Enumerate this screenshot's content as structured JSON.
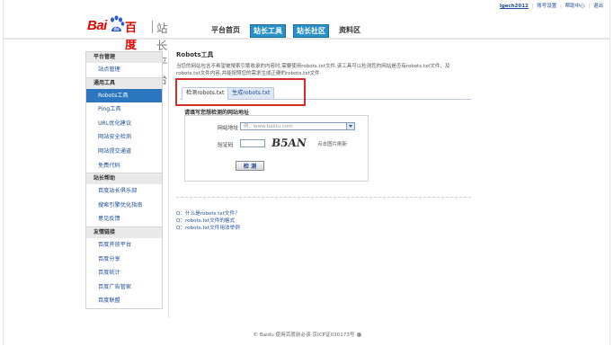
{
  "topbar": {
    "user": "lgech2012",
    "links": [
      "账号设置",
      "帮助中心",
      "退出"
    ]
  },
  "logo": {
    "brand_latin": "Bai",
    "brand_paw_text": "du",
    "brand_cn": "百度",
    "platform": "站长平台"
  },
  "nav": {
    "items": [
      "平台首页",
      "站长工具",
      "站长社区",
      "资料区"
    ]
  },
  "sidebar": {
    "sections": [
      {
        "head": "平台管理",
        "links": [
          "站点管理"
        ]
      },
      {
        "head": "通用工具",
        "links": [
          "Robots工具",
          "Ping工具",
          "URL优化建议",
          "网站安全检测",
          "网站提交通道",
          "免费代码"
        ]
      },
      {
        "head": "站长帮助",
        "links": [
          "百度站长俱乐部",
          "搜索引擎优化指南",
          "意见反馈"
        ]
      },
      {
        "head": "友情链接",
        "links": [
          "百度开放平台",
          "百度分享",
          "百度统计",
          "百度广告管家",
          "百度联盟"
        ]
      }
    ]
  },
  "content": {
    "title": "Robots工具",
    "desc_line1": "当您的网站包含不希望被搜索引擎收录的内容时,需要使用robots.txt文件,该工具可以检测您的网站是否有robots.txt文件，及",
    "desc_line2": "robots.txt文件内容,并能按照您的需求生成正确的robots.txt文件",
    "tabs": [
      "检测robots.txt",
      "生成robots.txt"
    ]
  },
  "form": {
    "title": "请填写您想检测的网站地址",
    "url_label": "网站地址",
    "url_placeholder": "例：www.baidu.com",
    "captcha_label": "验证码",
    "captcha_text": "B5AN",
    "refresh_label": "点击图片刷新",
    "submit_label": "检 测"
  },
  "faq": [
    "Q：什么是robots.txt文件？",
    "Q：robots.txt文件的格式",
    "Q：robots.txt文件用法举例"
  ],
  "footer": {
    "text": "© Baidu 使用百度前必读 京ICP证030173号"
  },
  "colors": {
    "brand_red": "#e10602",
    "accent_blue": "#2b90c6",
    "link_blue": "#1d4e9c",
    "highlight_red": "#d62b2b"
  }
}
